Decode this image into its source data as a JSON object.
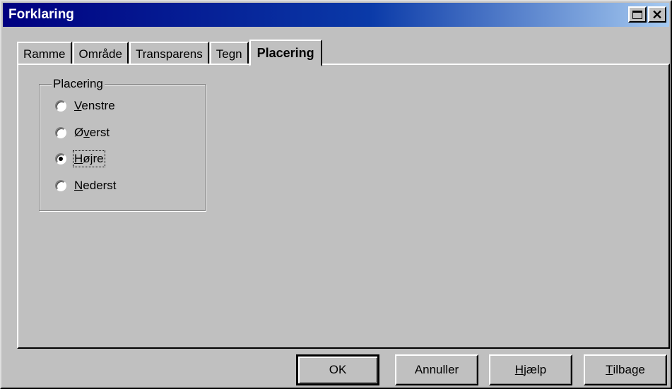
{
  "window": {
    "title": "Forklaring"
  },
  "tabs": [
    {
      "label": "Ramme"
    },
    {
      "label": "Område"
    },
    {
      "label": "Transparens"
    },
    {
      "label": "Tegn"
    },
    {
      "label": "Placering",
      "active": true
    }
  ],
  "placement": {
    "group_label": "Placering",
    "options": [
      {
        "label": "Venstre",
        "mnemonic": "V",
        "rest": "enstre",
        "selected": false
      },
      {
        "label": "Øverst",
        "pre": "Ø",
        "mnemonic": "v",
        "rest": "erst",
        "selected": false
      },
      {
        "label": "Højre",
        "mnemonic": "H",
        "rest": "øjre",
        "selected": true
      },
      {
        "label": "Nederst",
        "mnemonic": "N",
        "rest": "ederst",
        "selected": false
      }
    ]
  },
  "buttons": {
    "ok": "OK",
    "cancel": "Annuller",
    "help_mn": "H",
    "help_rest": "jælp",
    "back_mn": "T",
    "back_rest": "ilbage"
  }
}
